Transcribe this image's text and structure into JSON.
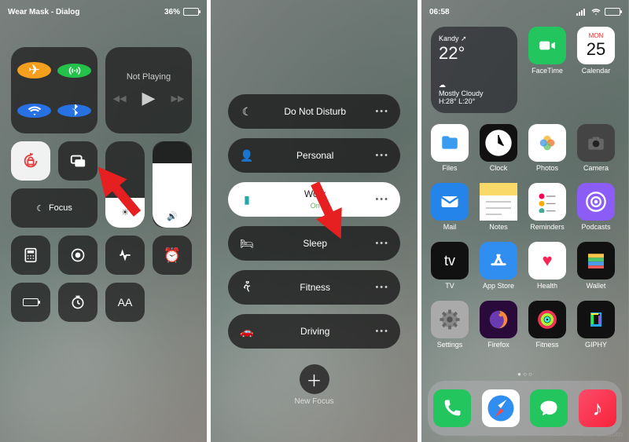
{
  "panel1": {
    "status_left": "Wear Mask - Dialog",
    "battery_text": "36%",
    "media_title": "Not Playing",
    "focus_label": "Focus",
    "brightness_pct": 35,
    "volume_pct": 75
  },
  "panel2": {
    "items": [
      {
        "label": "Do Not Disturb",
        "icon": "moon-icon"
      },
      {
        "label": "Personal",
        "icon": "person-icon"
      },
      {
        "label": "Work",
        "sub": "On",
        "icon": "badge-icon",
        "active": true
      },
      {
        "label": "Sleep",
        "icon": "bed-icon"
      },
      {
        "label": "Fitness",
        "icon": "fitness-icon"
      },
      {
        "label": "Driving",
        "icon": "car-icon"
      }
    ],
    "new_focus": "New Focus"
  },
  "panel3": {
    "status_time": "06:58",
    "weather": {
      "city": "Kandy",
      "temp": "22°",
      "cond": "Mostly Cloudy",
      "hl": "H:28° L:20°"
    },
    "calendar": {
      "day": "MON",
      "date": "25"
    },
    "row1": [
      {
        "name": "facetime",
        "label": "FaceTime",
        "bg": "#22c55e",
        "glyph": "▢"
      },
      {
        "name": "calendar",
        "label": "Calendar",
        "bg": "#fff",
        "glyph": ""
      }
    ],
    "row2": [
      {
        "name": "files",
        "label": "Files",
        "bg": "#fff",
        "glyph": "📁"
      },
      {
        "name": "clock",
        "label": "Clock",
        "bg": "#111",
        "glyph": "🕒"
      },
      {
        "name": "photos",
        "label": "Photos",
        "bg": "#fff",
        "glyph": "✿"
      },
      {
        "name": "camera",
        "label": "Camera",
        "bg": "#444",
        "glyph": "◉"
      }
    ],
    "row3": [
      {
        "name": "mail",
        "label": "Mail",
        "bg": "#2584ea",
        "glyph": "✉"
      },
      {
        "name": "notes",
        "label": "Notes",
        "bg": "#f9e79f",
        "glyph": "≡"
      },
      {
        "name": "reminders",
        "label": "Reminders",
        "bg": "#fff",
        "glyph": "☰"
      },
      {
        "name": "podcasts",
        "label": "Podcasts",
        "bg": "#8b5cf6",
        "glyph": "◉"
      }
    ],
    "row4": [
      {
        "name": "tv",
        "label": "TV",
        "bg": "#111",
        "glyph": "tv"
      },
      {
        "name": "appstore",
        "label": "App Store",
        "bg": "#2f8ef0",
        "glyph": "A"
      },
      {
        "name": "health",
        "label": "Health",
        "bg": "#fff",
        "glyph": "♥"
      },
      {
        "name": "wallet",
        "label": "Wallet",
        "bg": "#111",
        "glyph": "▤"
      }
    ],
    "row5": [
      {
        "name": "settings",
        "label": "Settings",
        "bg": "#aaa",
        "glyph": "⚙"
      },
      {
        "name": "firefox",
        "label": "Firefox",
        "bg": "#2a0a3a",
        "glyph": "◔"
      },
      {
        "name": "fitness",
        "label": "Fitness",
        "bg": "#111",
        "glyph": "◎"
      },
      {
        "name": "giphy",
        "label": "GIPHY",
        "bg": "#111",
        "glyph": "◈"
      }
    ],
    "dock": [
      {
        "name": "phone",
        "bg": "#22c55e",
        "glyph": "✆"
      },
      {
        "name": "safari",
        "bg": "#fff",
        "glyph": "◎"
      },
      {
        "name": "messages",
        "bg": "#22c55e",
        "glyph": "💬"
      },
      {
        "name": "music",
        "bg": "linear-gradient(135deg,#fb4c6a,#fa233b)",
        "glyph": "♪"
      }
    ]
  },
  "source": "wsxdn.com"
}
